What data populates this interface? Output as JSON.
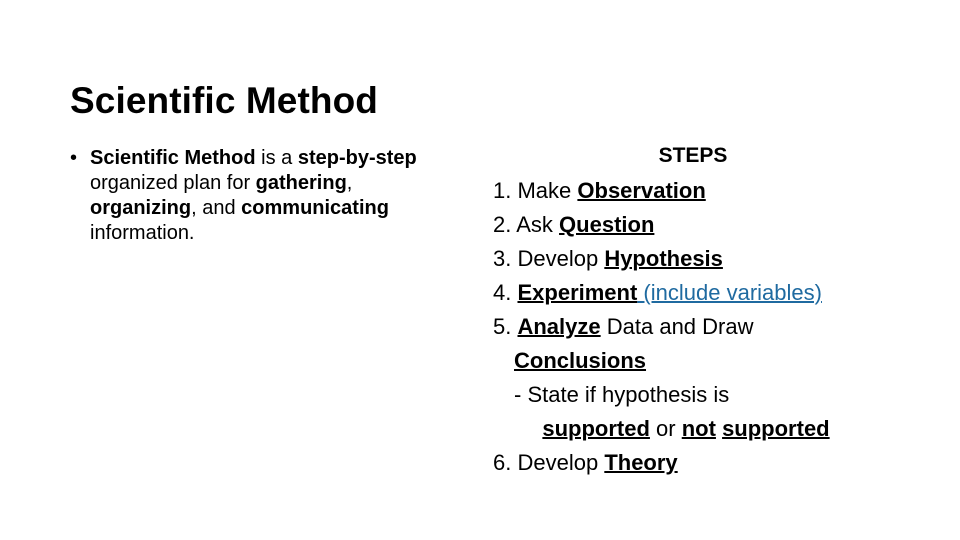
{
  "slide": {
    "title": "Scientific Method",
    "background_color": "#ffffff",
    "text_color": "#000000",
    "link_color": "#1f6aa0"
  },
  "left_column": {
    "bullet_marker": "•",
    "bullet": {
      "seg1_bold": "Scientific Method",
      "seg2_plain": " is a ",
      "seg3_bold": "step-by-step",
      "seg4_plain": " organized plan for ",
      "seg5_bold": "gathering",
      "seg6_plain": ", ",
      "seg7_bold": "organizing",
      "seg8_plain": ", and ",
      "seg9_bold": "communicating",
      "seg10_plain": " information."
    }
  },
  "right_column": {
    "header": "STEPS",
    "steps": [
      {
        "number": "1.",
        "pre": " Make ",
        "key": "Observation",
        "post": ""
      },
      {
        "number": "2.",
        "pre": " Ask ",
        "key": "Question",
        "post": ""
      },
      {
        "number": "3.",
        "pre": " Develop ",
        "key": "Hypothesis",
        "post": ""
      },
      {
        "number": "4.",
        "pre": " ",
        "key": "Experiment",
        "link": " (include variables)"
      },
      {
        "number": "5.",
        "pre": " ",
        "key": "Analyze",
        "post": " Data and Draw",
        "wrap_key": "Conclusions"
      },
      {
        "number": "6.",
        "pre": " Develop ",
        "key": "Theory",
        "post": ""
      }
    ],
    "sub_note": {
      "line1": "- State if hypothesis is",
      "line2_key_a": "supported",
      "line2_mid": " or ",
      "line2_key_b": "not",
      "line2_space": " ",
      "line2_key_c": "supported"
    }
  }
}
